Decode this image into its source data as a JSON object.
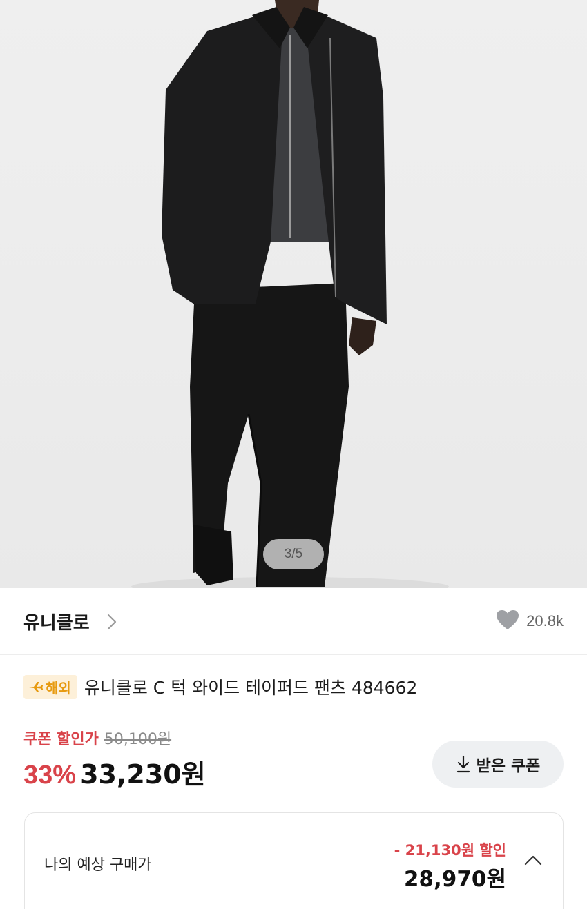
{
  "hero": {
    "pager_text": "3/5"
  },
  "brand": {
    "name": "유니클로",
    "like_count": "20.8k"
  },
  "product": {
    "badge_label": "해외",
    "title": "유니클로 C 턱 와이드 테이퍼드 팬츠 484662"
  },
  "price": {
    "coupon_label": "쿠폰 할인가",
    "original_price": "50,100원",
    "discount_rate": "33%",
    "sale_price": "33,230원",
    "coupon_button_label": "받은 쿠폰"
  },
  "expected": {
    "label": "나의 예상 구매가",
    "discount_text": "- 21,130원 할인",
    "final_price": "28,970원"
  },
  "colors": {
    "accent_red": "#d9434a",
    "badge_bg": "#fdf0d9",
    "badge_text": "#e79a10",
    "button_bg": "#eef0f2"
  }
}
